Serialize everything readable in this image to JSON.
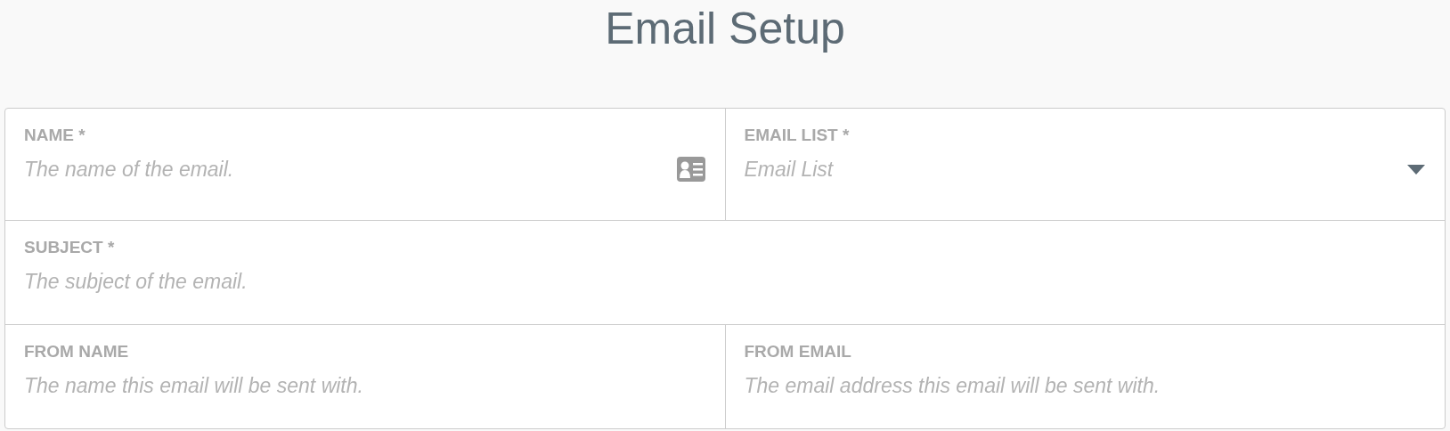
{
  "title": "Email Setup",
  "rows": [
    [
      {
        "label": "NAME *",
        "placeholder": "The name of the email.",
        "kind": "card"
      },
      {
        "label": "EMAIL LIST *",
        "placeholder": "Email List",
        "kind": "select"
      }
    ],
    [
      {
        "label": "SUBJECT *",
        "placeholder": "The subject of the email.",
        "kind": "text"
      }
    ],
    [
      {
        "label": "FROM NAME",
        "placeholder": "The name this email will be sent with.",
        "kind": "text"
      },
      {
        "label": "FROM EMAIL",
        "placeholder": "The email address this email will be sent with.",
        "kind": "text"
      }
    ]
  ]
}
